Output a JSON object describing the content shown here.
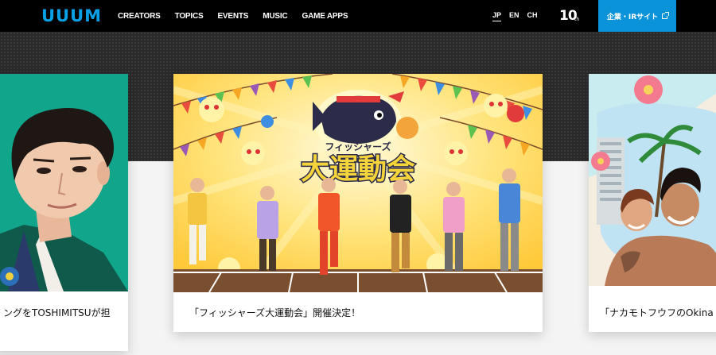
{
  "header": {
    "logo_text": "UUUM",
    "nav": [
      "CREATORS",
      "TOPICS",
      "EVENTS",
      "MUSIC",
      "GAME APPS"
    ],
    "languages": [
      {
        "code": "JP",
        "active": true
      },
      {
        "code": "EN",
        "active": false
      },
      {
        "code": "CH",
        "active": false
      }
    ],
    "anniversary": {
      "number": "10",
      "suffix": "th"
    },
    "ir_button": "企業・IRサイト",
    "ir_button_icon": "external-link-icon"
  },
  "cards": {
    "left": {
      "caption": "ングをTOSHIMITSUが担"
    },
    "center": {
      "caption": "「フィッシャーズ大運動会」開催決定！",
      "banner_small": "フィッシャーズ",
      "banner_big": "大運動会"
    },
    "right": {
      "caption": "「ナカモトフウフのOkina"
    }
  },
  "colors": {
    "brand_blue": "#0a93d8",
    "header_bg": "#000000",
    "left_card_bg": "#11a68c"
  }
}
